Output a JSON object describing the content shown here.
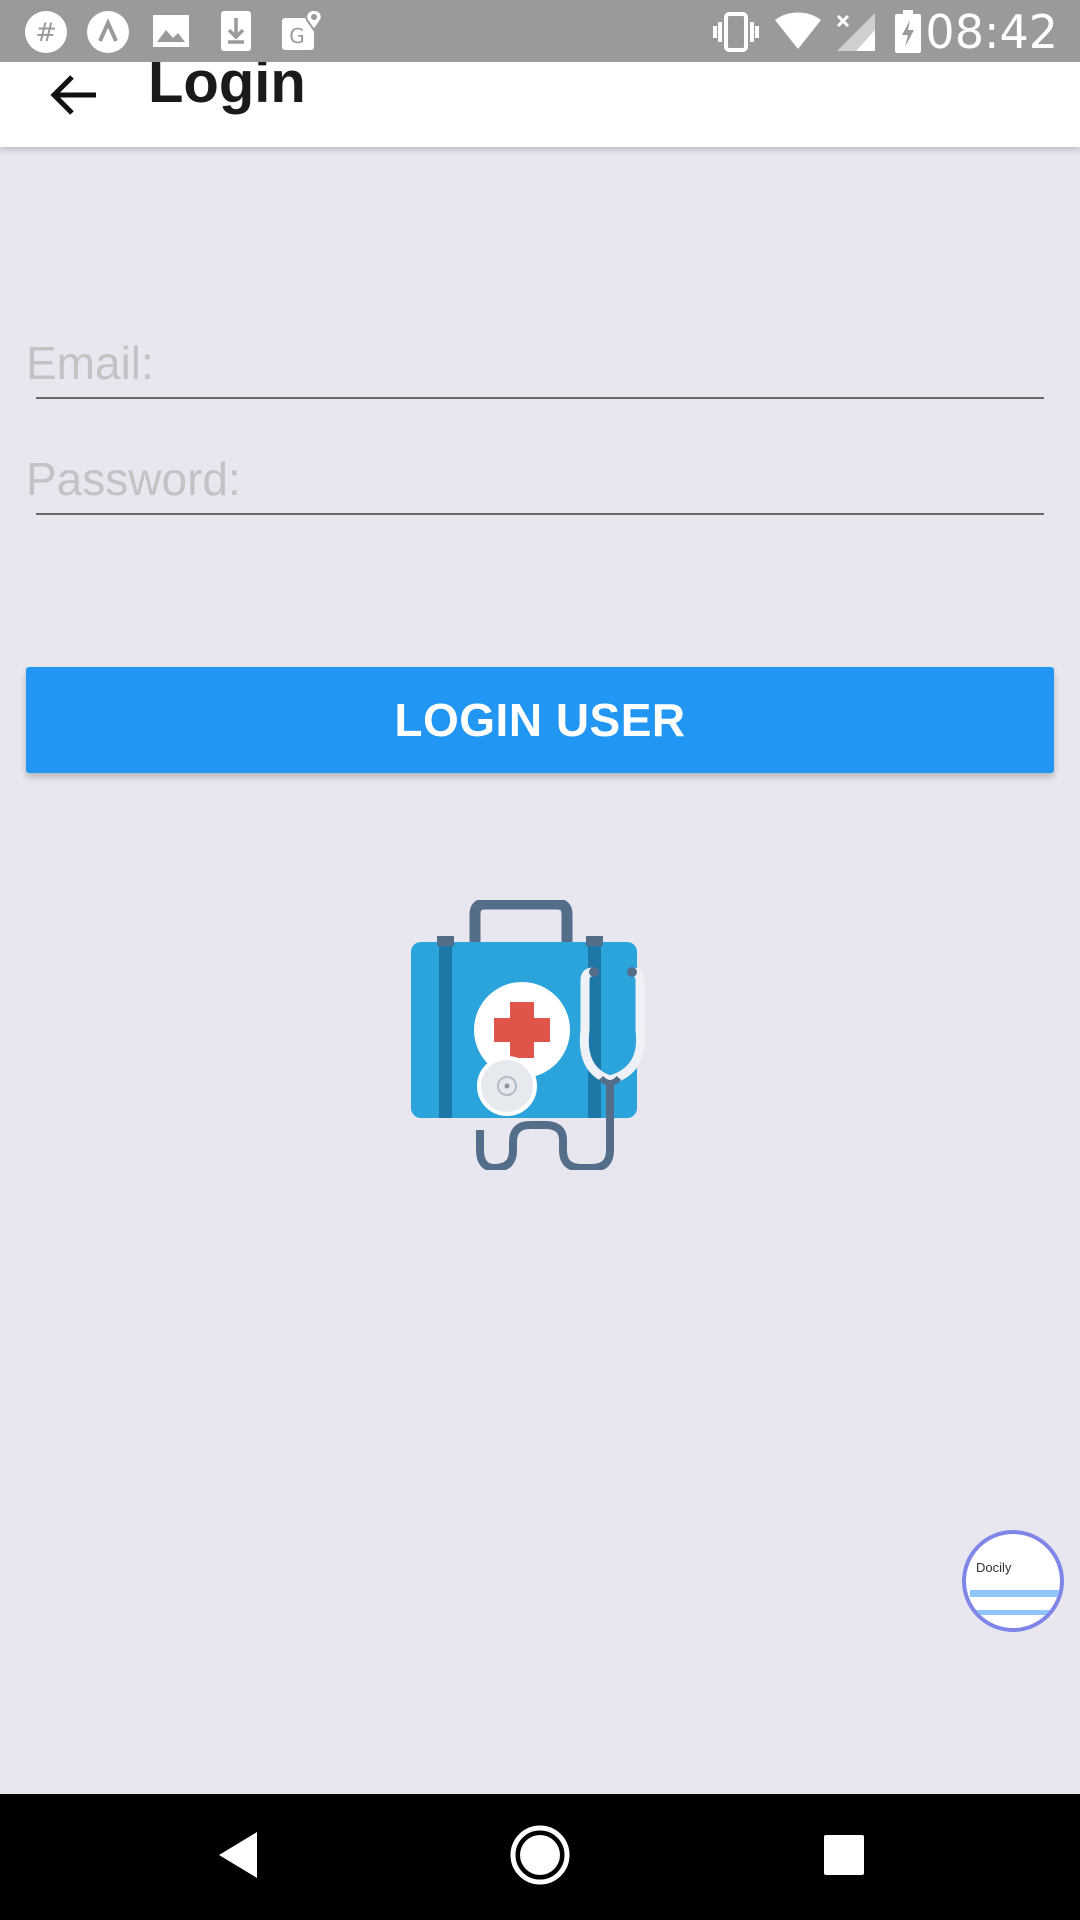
{
  "status_bar": {
    "time": "08:42",
    "left_icons": [
      "slack-icon",
      "app-icon",
      "image-icon",
      "download-icon",
      "maps-icon"
    ],
    "right_icons": [
      "vibrate-icon",
      "wifi-icon",
      "cell-signal-icon",
      "battery-charging-icon"
    ]
  },
  "app_bar": {
    "title": "Login"
  },
  "form": {
    "email_placeholder": "Email:",
    "password_placeholder": "Password:",
    "login_button_label": "LOGIN USER"
  },
  "floating_bubble": {
    "label": "Docily"
  },
  "colors": {
    "accent": "#2196f3",
    "background": "#e8e7ef",
    "status_bar": "#9a9a9a",
    "app_bar": "#ffffff"
  }
}
